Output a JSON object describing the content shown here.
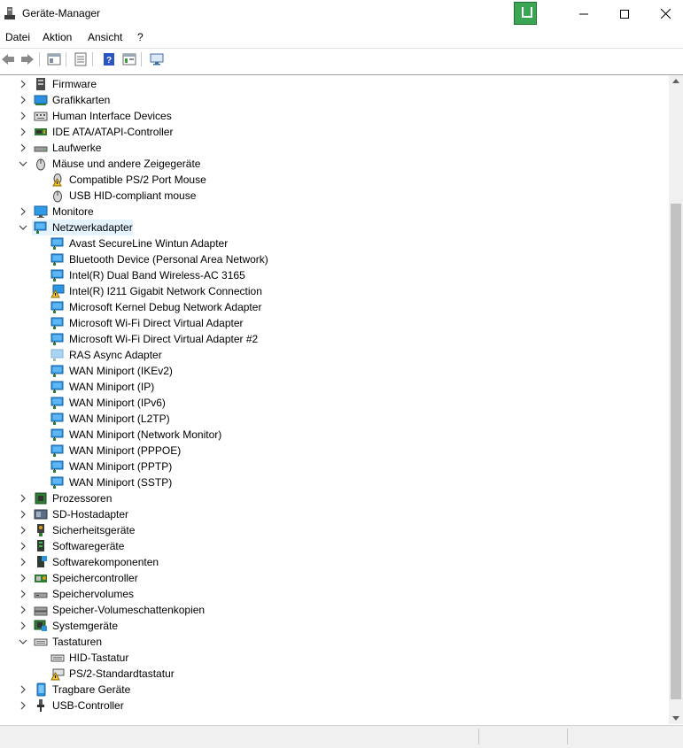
{
  "window": {
    "title": "Geräte-Manager",
    "controls": {
      "minimize": "minimize",
      "maximize": "maximize",
      "close": "close"
    }
  },
  "menu": [
    "Datei",
    "Aktion",
    "Ansicht",
    "?"
  ],
  "toolbar": [
    "back-icon",
    "forward-icon",
    "properties-icon",
    "device-list-icon",
    "help-icon",
    "view-icon",
    "monitor-icon"
  ],
  "tree": [
    {
      "label": "Firmware",
      "level": 0,
      "expander": "collapsed",
      "icon": "firmware-icon"
    },
    {
      "label": "Grafikkarten",
      "level": 0,
      "expander": "collapsed",
      "icon": "display-adapter-icon"
    },
    {
      "label": "Human Interface Devices",
      "level": 0,
      "expander": "collapsed",
      "icon": "hid-icon"
    },
    {
      "label": "IDE ATA/ATAPI-Controller",
      "level": 0,
      "expander": "collapsed",
      "icon": "ide-controller-icon"
    },
    {
      "label": "Laufwerke",
      "level": 0,
      "expander": "collapsed",
      "icon": "disk-drive-icon"
    },
    {
      "label": "Mäuse und andere Zeigegeräte",
      "level": 0,
      "expander": "expanded",
      "icon": "mouse-icon"
    },
    {
      "label": "Compatible PS/2 Port Mouse",
      "level": 1,
      "icon": "mouse-warning-icon"
    },
    {
      "label": "USB HID-compliant mouse",
      "level": 1,
      "icon": "mouse-icon"
    },
    {
      "label": "Monitore",
      "level": 0,
      "expander": "collapsed",
      "icon": "monitor-icon"
    },
    {
      "label": "Netzwerkadapter",
      "level": 0,
      "expander": "expanded",
      "icon": "network-adapter-icon",
      "selected": true
    },
    {
      "label": "Avast SecureLine Wintun Adapter",
      "level": 1,
      "icon": "network-adapter-icon"
    },
    {
      "label": "Bluetooth Device (Personal Area Network)",
      "level": 1,
      "icon": "network-adapter-icon"
    },
    {
      "label": "Intel(R) Dual Band Wireless-AC 3165",
      "level": 1,
      "icon": "network-adapter-icon"
    },
    {
      "label": "Intel(R) I211 Gigabit Network Connection",
      "level": 1,
      "icon": "network-adapter-warning-icon"
    },
    {
      "label": "Microsoft Kernel Debug Network Adapter",
      "level": 1,
      "icon": "network-adapter-icon"
    },
    {
      "label": "Microsoft Wi-Fi Direct Virtual Adapter",
      "level": 1,
      "icon": "network-adapter-icon"
    },
    {
      "label": "Microsoft Wi-Fi Direct Virtual Adapter #2",
      "level": 1,
      "icon": "network-adapter-icon"
    },
    {
      "label": "RAS Async Adapter",
      "level": 1,
      "icon": "network-adapter-disabled-icon"
    },
    {
      "label": "WAN Miniport (IKEv2)",
      "level": 1,
      "icon": "network-adapter-icon"
    },
    {
      "label": "WAN Miniport (IP)",
      "level": 1,
      "icon": "network-adapter-icon"
    },
    {
      "label": "WAN Miniport (IPv6)",
      "level": 1,
      "icon": "network-adapter-icon"
    },
    {
      "label": "WAN Miniport (L2TP)",
      "level": 1,
      "icon": "network-adapter-icon"
    },
    {
      "label": "WAN Miniport (Network Monitor)",
      "level": 1,
      "icon": "network-adapter-icon"
    },
    {
      "label": "WAN Miniport (PPPOE)",
      "level": 1,
      "icon": "network-adapter-icon"
    },
    {
      "label": "WAN Miniport (PPTP)",
      "level": 1,
      "icon": "network-adapter-icon"
    },
    {
      "label": "WAN Miniport (SSTP)",
      "level": 1,
      "icon": "network-adapter-icon"
    },
    {
      "label": "Prozessoren",
      "level": 0,
      "expander": "collapsed",
      "icon": "processor-icon"
    },
    {
      "label": "SD-Hostadapter",
      "level": 0,
      "expander": "collapsed",
      "icon": "sd-host-icon"
    },
    {
      "label": "Sicherheitsgeräte",
      "level": 0,
      "expander": "collapsed",
      "icon": "security-device-icon"
    },
    {
      "label": "Softwaregeräte",
      "level": 0,
      "expander": "collapsed",
      "icon": "software-device-icon"
    },
    {
      "label": "Softwarekomponenten",
      "level": 0,
      "expander": "collapsed",
      "icon": "software-component-icon"
    },
    {
      "label": "Speichercontroller",
      "level": 0,
      "expander": "collapsed",
      "icon": "storage-controller-icon"
    },
    {
      "label": "Speichervolumes",
      "level": 0,
      "expander": "collapsed",
      "icon": "storage-volume-icon"
    },
    {
      "label": "Speicher-Volumeschattenkopien",
      "level": 0,
      "expander": "collapsed",
      "icon": "shadow-copy-icon"
    },
    {
      "label": "Systemgeräte",
      "level": 0,
      "expander": "collapsed",
      "icon": "system-device-icon"
    },
    {
      "label": "Tastaturen",
      "level": 0,
      "expander": "expanded",
      "icon": "keyboard-icon"
    },
    {
      "label": "HID-Tastatur",
      "level": 1,
      "icon": "keyboard-icon"
    },
    {
      "label": "PS/2-Standardtastatur",
      "level": 1,
      "icon": "keyboard-warning-icon"
    },
    {
      "label": "Tragbare Geräte",
      "level": 0,
      "expander": "collapsed",
      "icon": "portable-device-icon"
    },
    {
      "label": "USB-Controller",
      "level": 0,
      "expander": "collapsed",
      "icon": "usb-icon"
    }
  ],
  "colors": {
    "selection": "#e5f3ff",
    "network_blue": "#1e88d6",
    "warning": "#f2c230"
  }
}
